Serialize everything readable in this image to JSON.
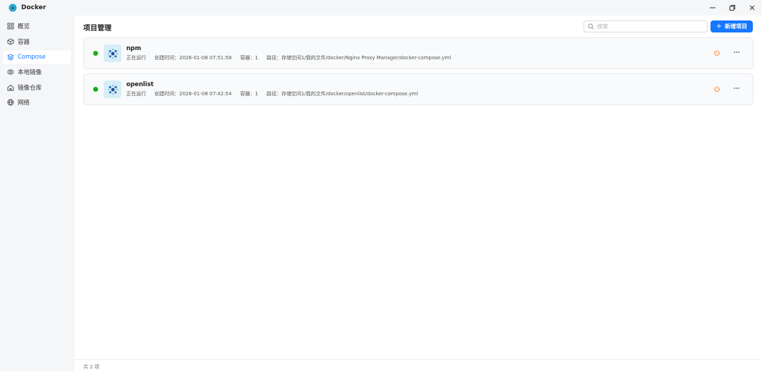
{
  "app": {
    "title": "Docker"
  },
  "sidebar": {
    "items": [
      {
        "label": "概览",
        "icon": "grid-icon",
        "active": false
      },
      {
        "label": "容器",
        "icon": "cube-icon",
        "active": false
      },
      {
        "label": "Compose",
        "icon": "layers-icon",
        "active": true
      },
      {
        "label": "本地镜像",
        "icon": "disc-icon",
        "active": false
      },
      {
        "label": "镜像仓库",
        "icon": "home-icon",
        "active": false
      },
      {
        "label": "网络",
        "icon": "globe-icon",
        "active": false
      }
    ]
  },
  "main": {
    "title": "项目管理",
    "search_placeholder": "搜索",
    "add_label": "新增项目",
    "accent_color": "#1677ff",
    "projects": [
      {
        "name": "npm",
        "status": "正在运行",
        "created": "创建时间：2026-01-08 07:51:58",
        "containers": "容器：1",
        "path": "路径：存储空间1/我的文件/docker/Nginx Proxy Manager/docker-compose.yml"
      },
      {
        "name": "openlist",
        "status": "正在运行",
        "created": "创建时间：2026-01-08 07:42:54",
        "containers": "容器：1",
        "path": "路径：存储空间1/我的文件/docker/openlist/docker-compose.yml"
      }
    ],
    "footer_count": "共 2 项",
    "status_color": "#1aad19",
    "power_color": "#f08a3c"
  }
}
